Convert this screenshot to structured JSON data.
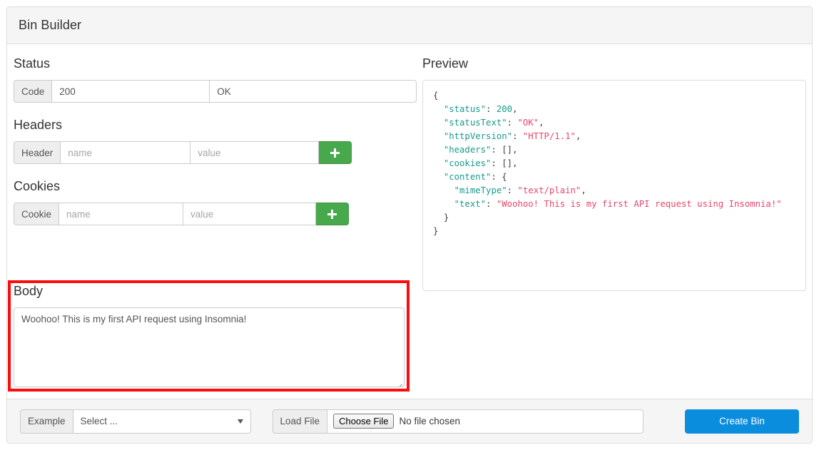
{
  "panel": {
    "title": "Bin Builder"
  },
  "status": {
    "heading": "Status",
    "code_label": "Code",
    "code_value": "200",
    "status_text_value": "OK"
  },
  "headers": {
    "heading": "Headers",
    "row_label": "Header",
    "name_placeholder": "name",
    "value_placeholder": "value",
    "add_icon": "plus-icon"
  },
  "cookies": {
    "heading": "Cookies",
    "row_label": "Cookie",
    "name_placeholder": "name",
    "value_placeholder": "value",
    "add_icon": "plus-icon"
  },
  "body": {
    "heading": "Body",
    "text_value": "Woohoo! This is my first API request using Insomnia!",
    "mime_label": "mimeType",
    "mime_value": "text/plain",
    "highlight_color": "#fb0d0d"
  },
  "preview": {
    "heading": "Preview",
    "json_lines": [
      {
        "indent": 0,
        "parts": [
          {
            "t": "{",
            "c": "p"
          }
        ]
      },
      {
        "indent": 1,
        "parts": [
          {
            "t": "\"status\"",
            "c": "k"
          },
          {
            "t": ": ",
            "c": "p"
          },
          {
            "t": "200",
            "c": "n"
          },
          {
            "t": ",",
            "c": "p"
          }
        ]
      },
      {
        "indent": 1,
        "parts": [
          {
            "t": "\"statusText\"",
            "c": "k"
          },
          {
            "t": ": ",
            "c": "p"
          },
          {
            "t": "\"OK\"",
            "c": "s"
          },
          {
            "t": ",",
            "c": "p"
          }
        ]
      },
      {
        "indent": 1,
        "parts": [
          {
            "t": "\"httpVersion\"",
            "c": "k"
          },
          {
            "t": ": ",
            "c": "p"
          },
          {
            "t": "\"HTTP/1.1\"",
            "c": "s"
          },
          {
            "t": ",",
            "c": "p"
          }
        ]
      },
      {
        "indent": 1,
        "parts": [
          {
            "t": "\"headers\"",
            "c": "k"
          },
          {
            "t": ": [],",
            "c": "p"
          }
        ]
      },
      {
        "indent": 1,
        "parts": [
          {
            "t": "\"cookies\"",
            "c": "k"
          },
          {
            "t": ": [],",
            "c": "p"
          }
        ]
      },
      {
        "indent": 1,
        "parts": [
          {
            "t": "\"content\"",
            "c": "k"
          },
          {
            "t": ": {",
            "c": "p"
          }
        ]
      },
      {
        "indent": 2,
        "parts": [
          {
            "t": "\"mimeType\"",
            "c": "k"
          },
          {
            "t": ": ",
            "c": "p"
          },
          {
            "t": "\"text/plain\"",
            "c": "s"
          },
          {
            "t": ",",
            "c": "p"
          }
        ]
      },
      {
        "indent": 2,
        "parts": [
          {
            "t": "\"text\"",
            "c": "k"
          },
          {
            "t": ": ",
            "c": "p"
          },
          {
            "t": "\"Woohoo! This is my first API request using Insomnia!\"",
            "c": "s"
          }
        ]
      },
      {
        "indent": 1,
        "parts": [
          {
            "t": "}",
            "c": "p"
          }
        ]
      },
      {
        "indent": 0,
        "parts": [
          {
            "t": "}",
            "c": "p"
          }
        ]
      }
    ]
  },
  "footer": {
    "example_label": "Example",
    "example_selected": "Select ...",
    "example_icon": "chevron-down-icon",
    "load_file_label": "Load File",
    "choose_file_label": "Choose File",
    "no_file_text": "No file chosen",
    "create_bin_label": "Create Bin",
    "create_bin_color": "#0b8ddd"
  }
}
